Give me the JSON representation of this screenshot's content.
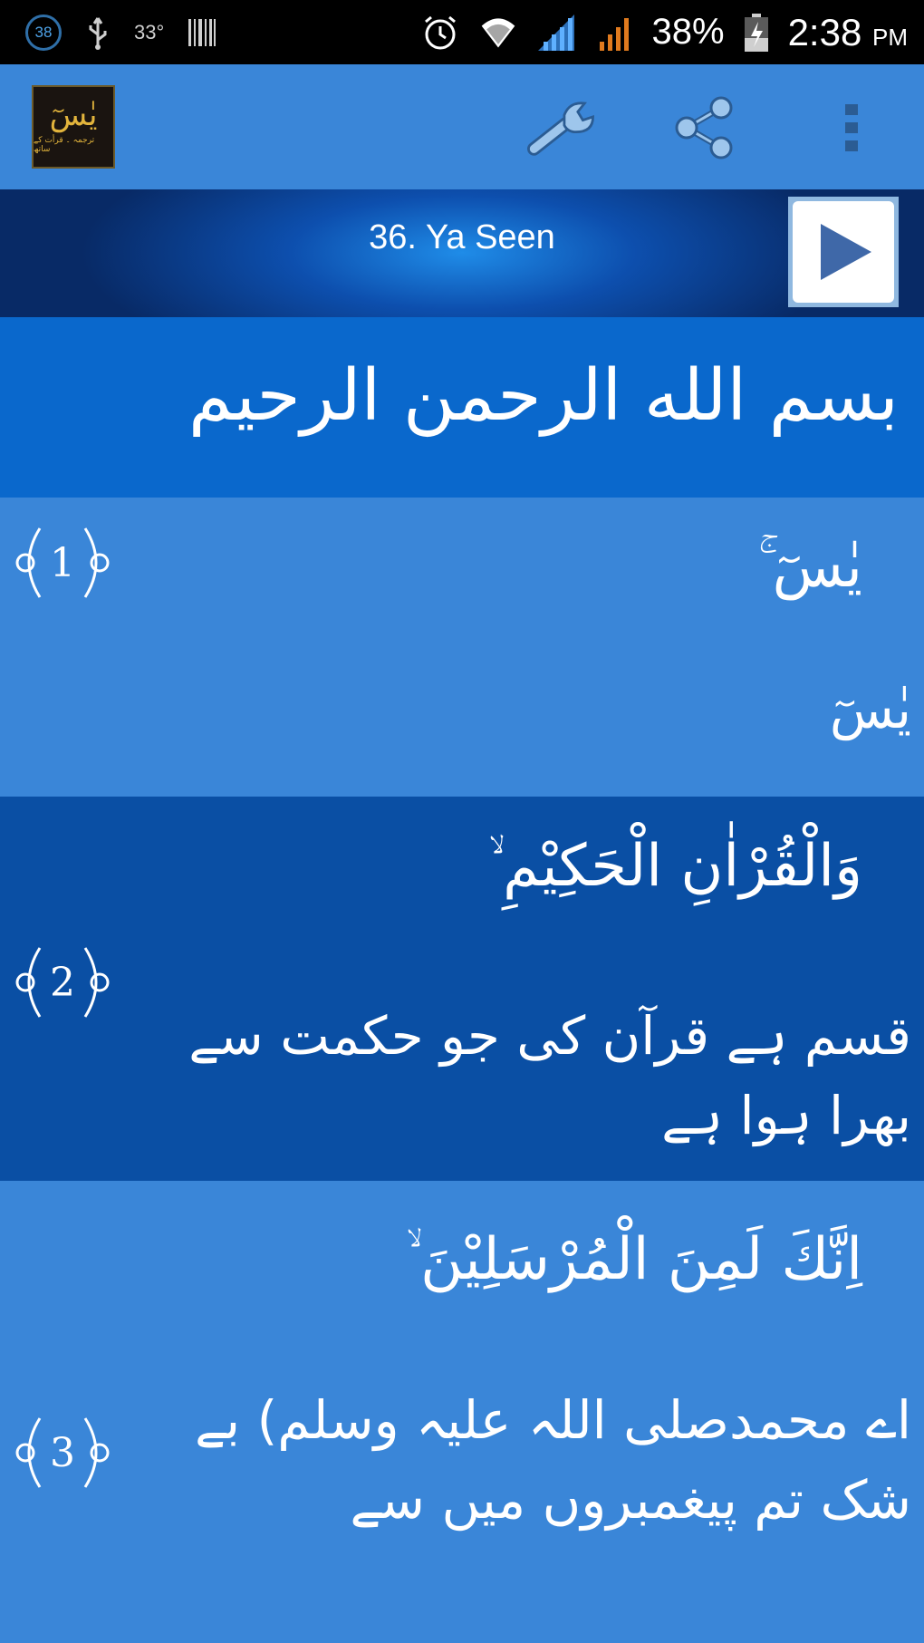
{
  "status_bar": {
    "notification_count": "38",
    "temperature": "33°",
    "battery_percent": "38%",
    "time": "2:38",
    "time_suffix": "PM"
  },
  "action_bar": {
    "logo_text": "یٰسٓ",
    "logo_subtext": "ترجمہ ۔ قرأت کے ساتھ",
    "icons": [
      "wrench-icon",
      "share-icon",
      "overflow-menu-icon"
    ]
  },
  "header": {
    "title": "36. Ya Seen"
  },
  "bismillah": "بسم الله الرحمن الرحيم",
  "verses": [
    {
      "number": "1",
      "arabic": "يٰسٓ ۚ",
      "urdu": "يٰسٓ"
    },
    {
      "number": "2",
      "arabic": "وَالْقُرْاٰنِ الْحَكِيْمِ ۙ",
      "urdu": "قسم ہے قرآن کی جو حکمت سے بھرا ہوا ہے"
    },
    {
      "number": "3",
      "arabic": "اِنَّكَ لَمِنَ الْمُرْسَلِيْنَ ۙ",
      "urdu": "اے محمدصلی اللہ علیہ وسلم) بے شک تم پیغمبروں میں سے"
    }
  ],
  "colors": {
    "action_bar": "#3a86d8",
    "bismillah_row": "#0a68cc",
    "alt_row": "#0a4fa4",
    "header_dark": "#082a66"
  }
}
